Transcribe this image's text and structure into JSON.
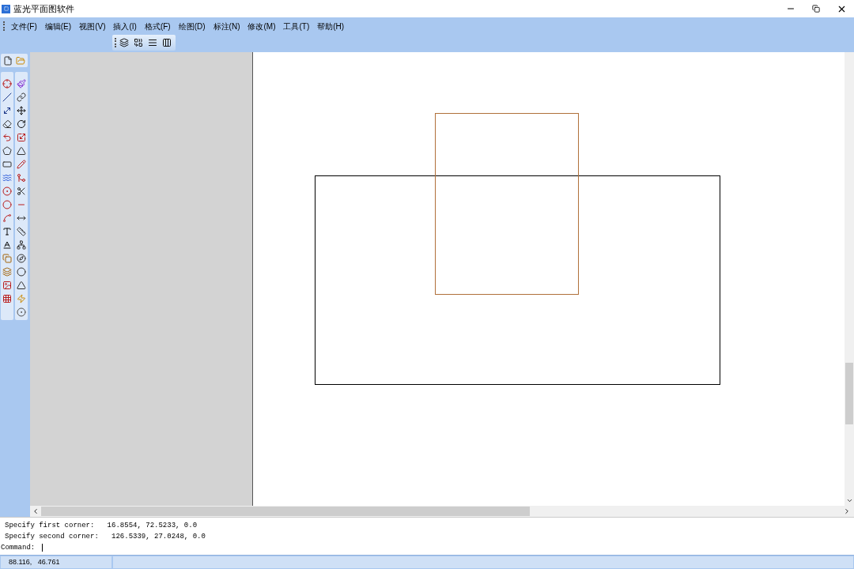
{
  "window": {
    "title": "蓝光平面图软件"
  },
  "menu": [
    {
      "label": "文件(F)"
    },
    {
      "label": "编辑(E)"
    },
    {
      "label": "视图(V)"
    },
    {
      "label": "插入(I)"
    },
    {
      "label": "格式(F)"
    },
    {
      "label": "绘图(D)"
    },
    {
      "label": "标注(N)"
    },
    {
      "label": "修改(M)"
    },
    {
      "label": "工具(T)"
    },
    {
      "label": "帮助(H)"
    }
  ],
  "shapes": [
    {
      "kind": "rectangle",
      "color": "#000000"
    },
    {
      "kind": "rectangle",
      "color": "#b0703a"
    }
  ],
  "command_lines": [
    "Specify first corner:   16.8554, 72.5233, 0.0",
    "Specify second corner:   126.5339, 27.0248, 0.0"
  ],
  "command_prompt": "Command:",
  "status_bar": {
    "coordinates": "88.116,   46.761"
  }
}
